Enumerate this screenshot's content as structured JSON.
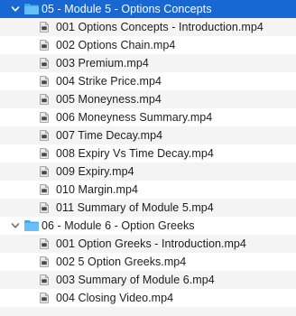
{
  "folders": [
    {
      "name": "05 - Module 5 - Options Concepts",
      "expanded": true,
      "selected": true,
      "files": [
        "001 Options Concepts - Introduction.mp4",
        "002 Options Chain.mp4",
        "003 Premium.mp4",
        "004 Strike Price.mp4",
        "005 Moneyness.mp4",
        "006 Moneyness Summary.mp4",
        "007 Time Decay.mp4",
        "008 Expiry Vs Time Decay.mp4",
        "009 Expiry.mp4",
        "010 Margin.mp4",
        "011 Summary of Module 5.mp4"
      ]
    },
    {
      "name": "06 - Module 6 - Option Greeks",
      "expanded": true,
      "selected": false,
      "files": [
        "001 Option Greeks - Introduction.mp4",
        "002 5 Option Greeks.mp4",
        "003 Summary of Module 6.mp4",
        "004 Closing Video.mp4"
      ]
    }
  ],
  "icons": {
    "folder": "folder-icon",
    "file": "video-file-icon",
    "disclosure": "chevron-down-icon"
  },
  "colors": {
    "selection": "#1967d2",
    "folder": "#5ab8f4",
    "alt_row": "#f4f4f5"
  }
}
